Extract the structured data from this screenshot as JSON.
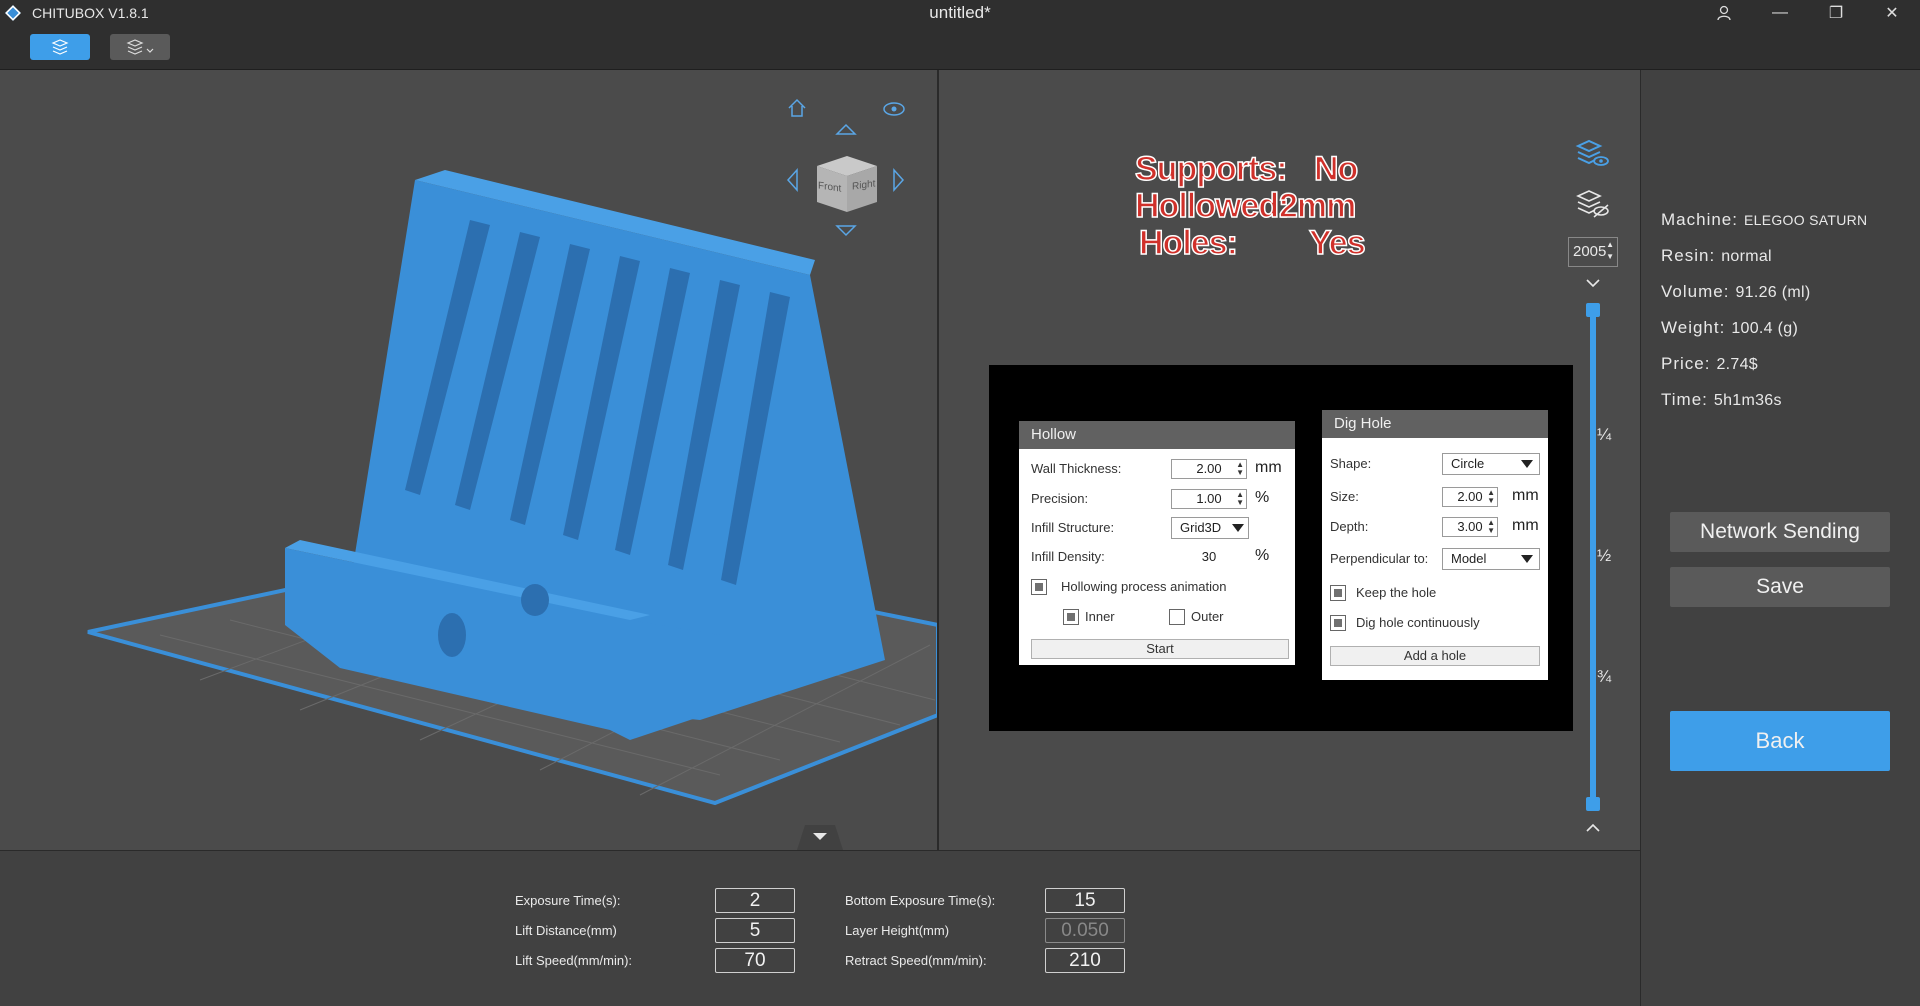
{
  "app": {
    "name": "CHITUBOX V1.8.1",
    "document_title": "untitled*"
  },
  "window_controls": {
    "user": "&#128100;",
    "minimize": "—",
    "restore": "❐",
    "close": "✕"
  },
  "toolbar": {
    "slice_icon": "layers-settings-icon",
    "second_icon": "layers-dropdown-icon"
  },
  "viewport": {
    "view_cube": {
      "front": "Front",
      "right": "Right"
    },
    "icons": [
      "home-icon",
      "eye-icon",
      "arrow-up-icon",
      "arrow-down-icon",
      "arrow-left-icon",
      "arrow-right-icon"
    ]
  },
  "annotation": {
    "line1_label": "Supports:",
    "line1_value": "No",
    "line2_label": "Hollowed:",
    "line2_value": "2mm",
    "line3_label": "Holes:",
    "line3_value": "Yes"
  },
  "hollow_dialog": {
    "title": "Hollow",
    "wall_thickness_label": "Wall Thickness:",
    "wall_thickness_value": "2.00",
    "wall_thickness_unit": "mm",
    "precision_label": "Precision:",
    "precision_value": "1.00",
    "precision_unit": "%",
    "infill_structure_label": "Infill Structure:",
    "infill_structure_value": "Grid3D",
    "infill_density_label": "Infill Density:",
    "infill_density_value": "30",
    "infill_density_unit": "%",
    "animation_label": "Hollowing process animation",
    "inner_label": "Inner",
    "outer_label": "Outer",
    "start_label": "Start"
  },
  "dig_hole_dialog": {
    "title": "Dig Hole",
    "shape_label": "Shape:",
    "shape_value": "Circle",
    "size_label": "Size:",
    "size_value": "2.00",
    "size_unit": "mm",
    "depth_label": "Depth:",
    "depth_value": "3.00",
    "depth_unit": "mm",
    "perpendicular_label": "Perpendicular to:",
    "perpendicular_value": "Model",
    "keep_hole_label": "Keep the hole",
    "continuous_label": "Dig hole continuously",
    "add_hole_label": "Add a hole"
  },
  "layer_slider": {
    "current_layer": "2005",
    "marks": [
      "¼",
      "½",
      "¾"
    ],
    "position_fraction": 1.0
  },
  "info": {
    "machine_label": "Machine:",
    "machine_value": "ELEGOO SATURN",
    "resin_label": "Resin:",
    "resin_value": "normal",
    "volume_label": "Volume:",
    "volume_value": "91.26  (ml)",
    "weight_label": "Weight:",
    "weight_value": "100.4  (g)",
    "price_label": "Price:",
    "price_value": "2.74$",
    "time_label": "Time:",
    "time_value": "5h1m36s"
  },
  "actions": {
    "network_sending": "Network Sending",
    "save": "Save",
    "back": "Back"
  },
  "print_settings": {
    "exposure_time_label": "Exposure Time(s):",
    "exposure_time_value": "2",
    "lift_distance_label": "Lift Distance(mm)",
    "lift_distance_value": "5",
    "lift_speed_label": "Lift Speed(mm/min):",
    "lift_speed_value": "70",
    "bottom_exposure_label": "Bottom Exposure Time(s):",
    "bottom_exposure_value": "15",
    "layer_height_label": "Layer Height(mm)",
    "layer_height_value": "0.050",
    "retract_speed_label": "Retract Speed(mm/min):",
    "retract_speed_value": "210"
  },
  "colors": {
    "accent": "#3e9ee9",
    "model": "#3a8fd8",
    "background": "#4b4b4b",
    "panel": "#414141",
    "annotation_red": "#d0302a"
  }
}
